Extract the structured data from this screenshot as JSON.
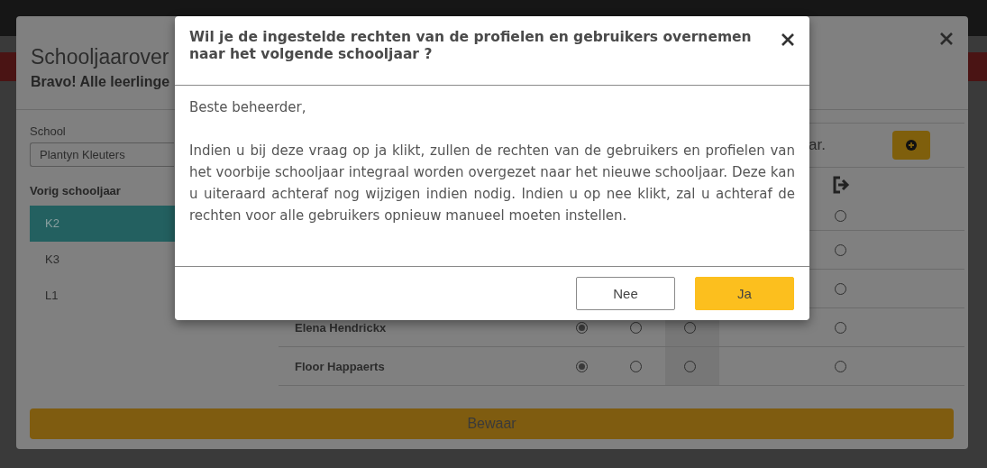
{
  "wizard": {
    "title": "Schooljaarover",
    "subtitle": "Bravo! Alle leerlinge",
    "school_label": "School",
    "school_value": "Plantyn Kleuters",
    "list_heading": "Vorig schooljaar",
    "classes": [
      {
        "label": "K2",
        "selected": true
      },
      {
        "label": "K3",
        "selected": false
      },
      {
        "label": "L1",
        "selected": false
      }
    ],
    "note": "ar.",
    "users": [
      {
        "radios": [
          {
            "checked": false
          }
        ]
      },
      {
        "radios": [
          {
            "checked": false
          }
        ]
      },
      {
        "radios": [
          {
            "checked": false
          }
        ]
      },
      {
        "name": "Elena Hendrickx",
        "radios": [
          {
            "checked": true
          },
          {
            "checked": false
          },
          {
            "checked": false
          },
          {
            "checked": false
          }
        ]
      },
      {
        "name": "Floor Happaerts",
        "radios": [
          {
            "checked": true
          },
          {
            "checked": false
          },
          {
            "checked": false
          },
          {
            "checked": false
          }
        ]
      }
    ],
    "save_button": "Bewaar"
  },
  "dialog": {
    "title": "Wil je de ingestelde rechten van de profielen en gebruikers overnemen naar het volgende schooljaar ?",
    "greeting": "Beste beheerder,",
    "body": "Indien u bij deze vraag op ja klikt, zullen de rechten van de gebruikers en profielen van het voorbije schooljaar integraal worden overgezet naar het nieuwe schooljaar. Deze kan u uiteraard achteraf nog wijzigen indien nodig. Indien u op nee klikt, zal u achteraf de rechten voor alle gebruikers opnieuw manueel moeten instellen.",
    "buttons": [
      {
        "label": "Nee",
        "kind": "secondary"
      },
      {
        "label": "Ja",
        "kind": "primary"
      }
    ]
  }
}
